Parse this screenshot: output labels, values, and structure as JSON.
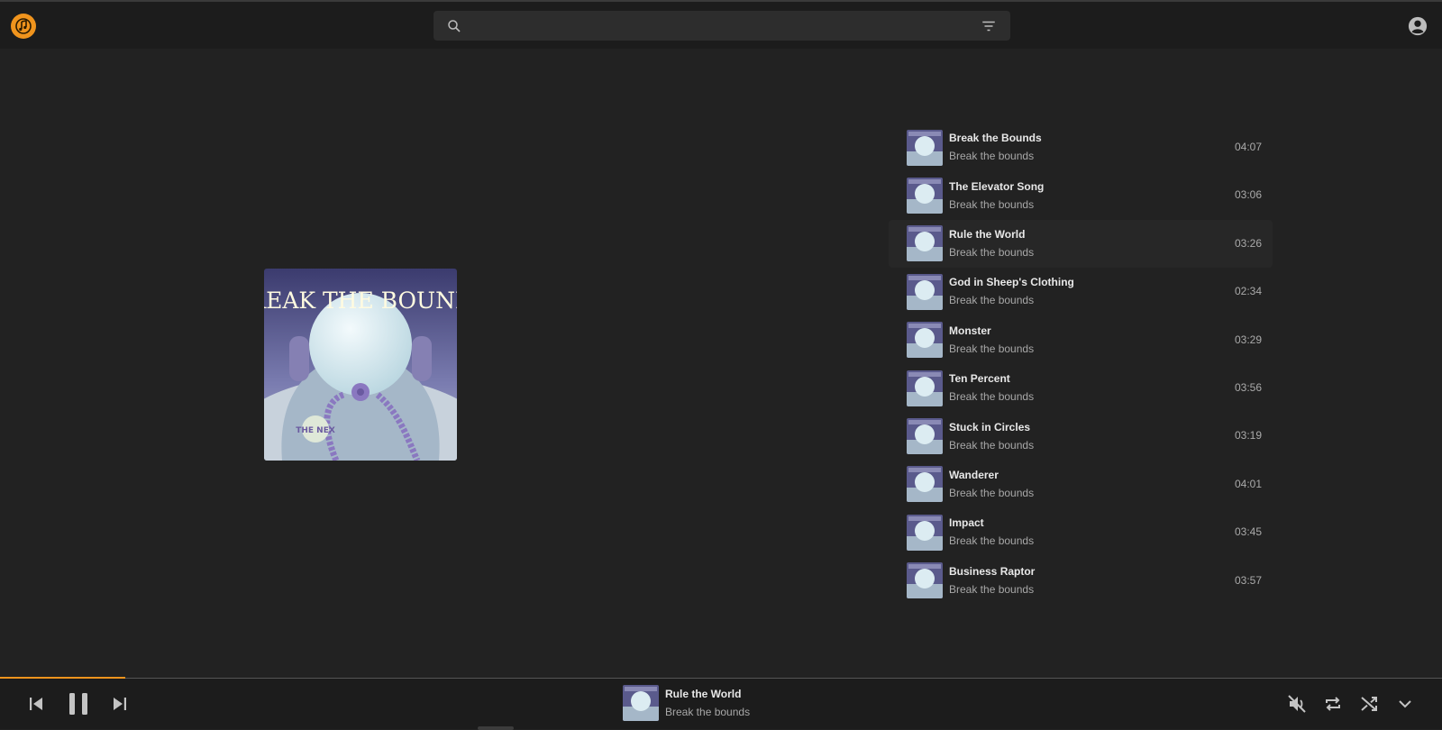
{
  "app": {
    "logo_icon": "music-note-logo-icon",
    "accent_color": "#f0941d"
  },
  "search": {
    "placeholder": "",
    "value": ""
  },
  "album": {
    "cover_text_top": "BREAK THE BOUNDS",
    "cover_badge_text": "THE NEX"
  },
  "tracks": [
    {
      "title": "Break the Bounds",
      "album": "Break the bounds",
      "duration": "04:07"
    },
    {
      "title": "The Elevator Song",
      "album": "Break the bounds",
      "duration": "03:06"
    },
    {
      "title": "Rule the World",
      "album": "Break the bounds",
      "duration": "03:26"
    },
    {
      "title": "God in Sheep's Clothing",
      "album": "Break the bounds",
      "duration": "02:34"
    },
    {
      "title": "Monster",
      "album": "Break the bounds",
      "duration": "03:29"
    },
    {
      "title": "Ten Percent",
      "album": "Break the bounds",
      "duration": "03:56"
    },
    {
      "title": "Stuck in Circles",
      "album": "Break the bounds",
      "duration": "03:19"
    },
    {
      "title": "Wanderer",
      "album": "Break the bounds",
      "duration": "04:01"
    },
    {
      "title": "Impact",
      "album": "Break the bounds",
      "duration": "03:45"
    },
    {
      "title": "Business Raptor",
      "album": "Break the bounds",
      "duration": "03:57"
    }
  ],
  "active_track_index": 2,
  "now_playing": {
    "title": "Rule the World",
    "album": "Break the bounds",
    "progress_fraction": 0.087,
    "state": "playing",
    "muted": true
  }
}
